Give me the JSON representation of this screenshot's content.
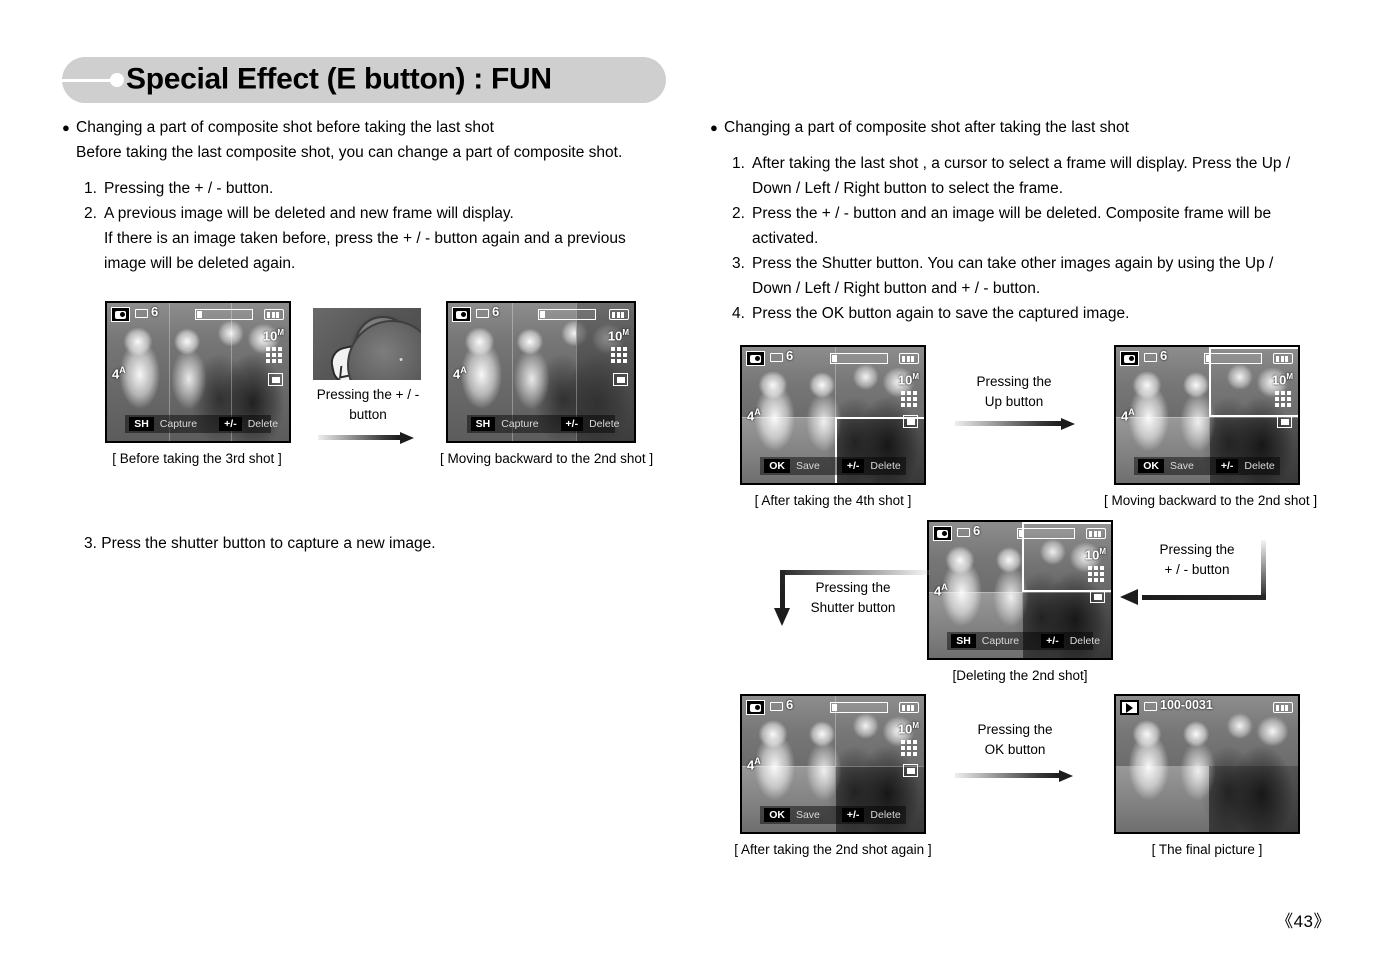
{
  "page": {
    "title": "Special Effect (E button) : FUN",
    "number": "《43》"
  },
  "left_column": {
    "bullet": {
      "line1": "Changing a part of composite shot before taking the last shot",
      "line2": "Before taking the last composite shot, you can change a part of composite shot."
    },
    "steps": [
      {
        "idx": "1.",
        "lines": [
          "Pressing the + / - button."
        ]
      },
      {
        "idx": "2.",
        "lines": [
          "A previous image will be deleted and new frame will display.",
          "If there is an image taken before, press the + / - button again and a previous",
          "image will be deleted again."
        ]
      }
    ],
    "step3": "3. Press the shutter button to capture a new image.",
    "figure_a": {
      "caption": "[ Before taking the 3rd shot ]",
      "osd": {
        "mode_icon": "camera-mode-icon",
        "card_icon": "memory-card-icon",
        "count": "6",
        "resolution": "10",
        "resolution_sup": "M",
        "flash": "4",
        "flash_sup": "A",
        "battery_icon": "battery-full-icon"
      },
      "cmdbar": {
        "key1": "SH",
        "label1": "Capture",
        "key2": "+/-",
        "label2": "Delete"
      }
    },
    "button_photo": {
      "button_glyph": "+/-",
      "zoom_glyph": "Q",
      "mic_glyph": "•",
      "label_line1": "Pressing the + / -",
      "label_line2": "button"
    },
    "figure_b": {
      "caption": "[ Moving backward to the 2nd shot ]",
      "osd": {
        "mode_icon": "camera-mode-icon",
        "card_icon": "memory-card-icon",
        "count": "6",
        "resolution": "10",
        "resolution_sup": "M",
        "flash": "4",
        "flash_sup": "A",
        "battery_icon": "battery-full-icon"
      },
      "cmdbar": {
        "key1": "SH",
        "label1": "Capture",
        "key2": "+/-",
        "label2": "Delete"
      }
    }
  },
  "right_column": {
    "bullet": {
      "line1": "Changing a part of composite shot after taking the last shot"
    },
    "steps": [
      {
        "idx": "1.",
        "lines": [
          "After taking the last shot , a cursor to select a frame will display. Press the Up /",
          "Down / Left / Right button to select the frame."
        ]
      },
      {
        "idx": "2.",
        "lines": [
          "Press the + / - button and an image will be deleted. Composite frame will be",
          "activated."
        ]
      },
      {
        "idx": "3.",
        "lines": [
          "Press the Shutter button. You can take other images again by using the Up /",
          "Down / Left / Right button and + / - button."
        ]
      },
      {
        "idx": "4.",
        "lines": [
          "Press the OK button again to save the captured image."
        ]
      }
    ],
    "figure_1": {
      "caption": "[ After taking the 4th shot ]",
      "osd": {
        "count": "6",
        "resolution": "10",
        "resolution_sup": "M",
        "flash": "4",
        "flash_sup": "A"
      },
      "cmdbar": {
        "key1": "OK",
        "label1": "Save",
        "key2": "+/-",
        "label2": "Delete"
      }
    },
    "figure_2": {
      "caption": "[ Moving backward to the 2nd shot ]",
      "osd": {
        "count": "6",
        "resolution": "10",
        "resolution_sup": "M",
        "flash": "4",
        "flash_sup": "A"
      },
      "cmdbar": {
        "key1": "OK",
        "label1": "Save",
        "key2": "+/-",
        "label2": "Delete"
      }
    },
    "figure_3": {
      "caption": "[Deleting the 2nd shot]",
      "osd": {
        "count": "6",
        "resolution": "10",
        "resolution_sup": "M",
        "flash": "4",
        "flash_sup": "A"
      },
      "cmdbar": {
        "key1": "SH",
        "label1": "Capture",
        "key2": "+/-",
        "label2": "Delete"
      }
    },
    "figure_4": {
      "caption": "[ After taking the 2nd shot again ]",
      "osd": {
        "count": "6",
        "resolution": "10",
        "resolution_sup": "M",
        "flash": "4",
        "flash_sup": "A"
      },
      "cmdbar": {
        "key1": "OK",
        "label1": "Save",
        "key2": "+/-",
        "label2": "Delete"
      }
    },
    "figure_5": {
      "caption": "[ The final picture ]",
      "osd": {
        "file": "100-0031",
        "play_icon": "play-mode-icon",
        "battery_icon": "battery-full-icon"
      }
    },
    "arrows": {
      "up": {
        "l1": "Pressing the",
        "l2": "Up button"
      },
      "plusminus": {
        "l1": "Pressing the",
        "l2": "+ / - button"
      },
      "shutter": {
        "l1": "Pressing the",
        "l2": "Shutter button"
      },
      "ok": {
        "l1": "Pressing the",
        "l2": "OK button"
      }
    }
  }
}
